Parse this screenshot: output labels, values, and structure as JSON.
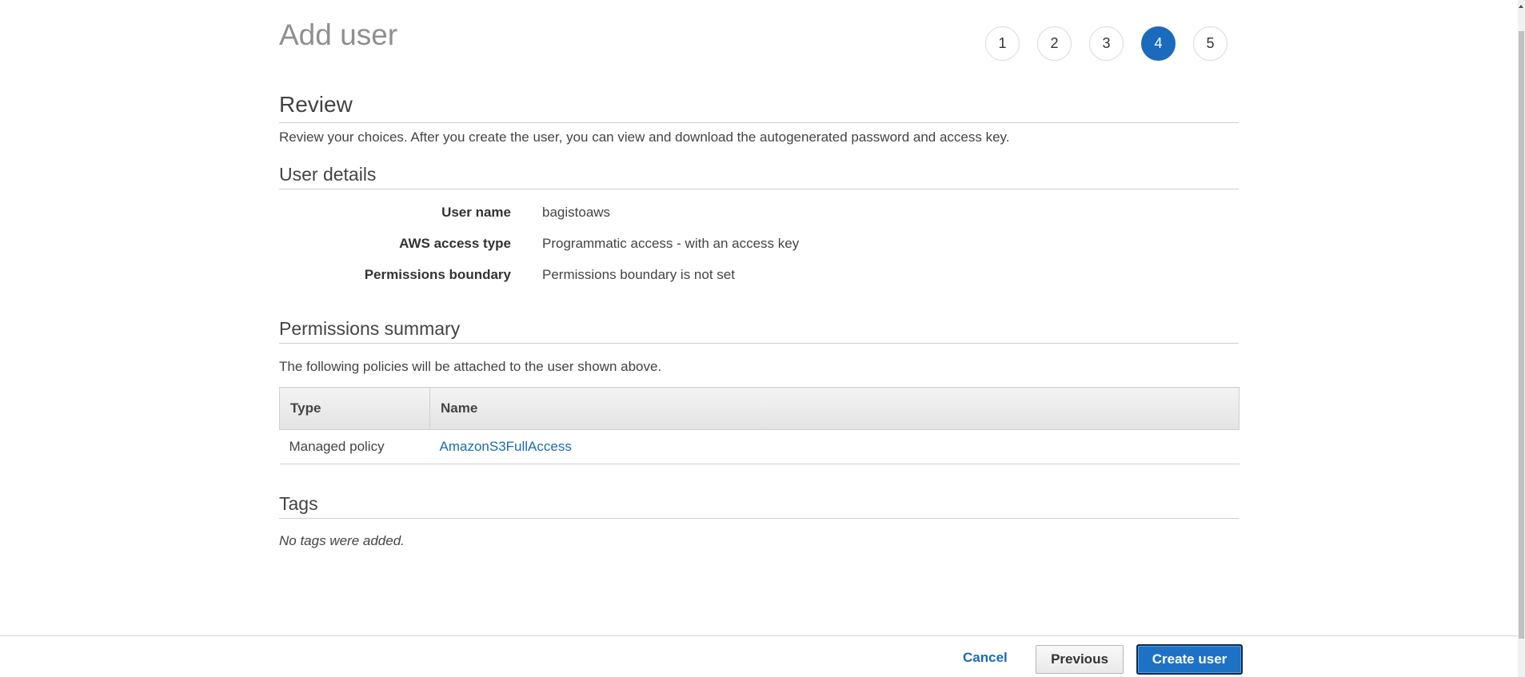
{
  "page": {
    "title": "Add user"
  },
  "wizard": {
    "steps": [
      "1",
      "2",
      "3",
      "4",
      "5"
    ],
    "active_step": "4"
  },
  "review": {
    "heading": "Review",
    "description": "Review your choices. After you create the user, you can view and download the autogenerated password and access key."
  },
  "user_details": {
    "heading": "User details",
    "rows": [
      {
        "label": "User name",
        "value": "bagistoaws"
      },
      {
        "label": "AWS access type",
        "value": "Programmatic access - with an access key"
      },
      {
        "label": "Permissions boundary",
        "value": "Permissions boundary is not set"
      }
    ]
  },
  "permissions_summary": {
    "heading": "Permissions summary",
    "description": "The following policies will be attached to the user shown above.",
    "columns": [
      "Type",
      "Name"
    ],
    "rows": [
      {
        "type": "Managed policy",
        "name": "AmazonS3FullAccess"
      }
    ]
  },
  "tags": {
    "heading": "Tags",
    "description": "No tags were added."
  },
  "footer": {
    "cancel_label": "Cancel",
    "previous_label": "Previous",
    "create_label": "Create user"
  },
  "colors": {
    "accent": "#1a6bbd",
    "link": "#1a6bb5",
    "title_gray": "#8f8f8f"
  }
}
